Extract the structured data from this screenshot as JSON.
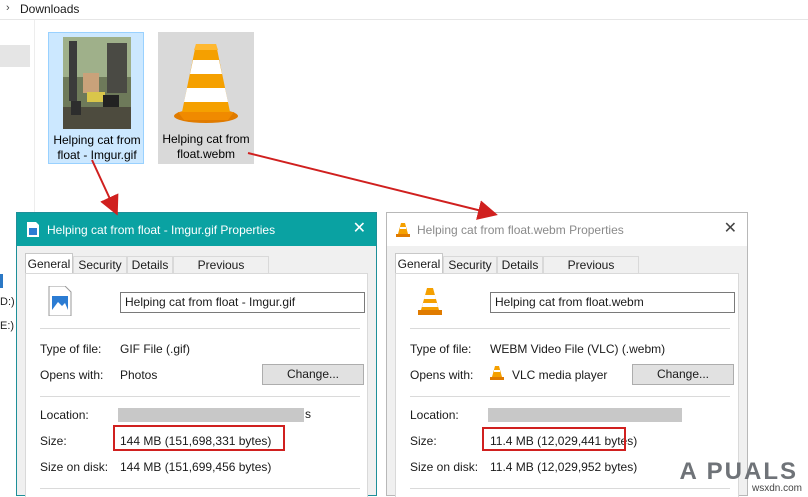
{
  "explorer": {
    "breadcrumb": "Downloads",
    "drives": [
      "D:)",
      "E:)"
    ],
    "files": [
      {
        "name_line1": "Helping cat from",
        "name_line2": "float - Imgur.gif",
        "thumb_icon": "cat-photo-thumbnail",
        "selected": true
      },
      {
        "name_line1": "Helping cat from",
        "name_line2": "float.webm",
        "thumb_icon": "vlc-cone-icon",
        "selected": false
      }
    ]
  },
  "dialog_gif": {
    "title": "Helping cat from float - Imgur.gif Properties",
    "tabs": [
      "General",
      "Security",
      "Details",
      "Previous Versions"
    ],
    "filename": "Helping cat from float - Imgur.gif",
    "type_label": "Type of file:",
    "type_value": "GIF File (.gif)",
    "opens_label": "Opens with:",
    "opens_value": "Photos",
    "change_button": "Change...",
    "location_label": "Location:",
    "location_suffix": "s",
    "size_label": "Size:",
    "size_value": "144 MB (151,698,331 bytes)",
    "disk_label": "Size on disk:",
    "disk_value": "144 MB (151,699,456 bytes)",
    "close": "✕"
  },
  "dialog_webm": {
    "title": "Helping cat from float.webm Properties",
    "tabs": [
      "General",
      "Security",
      "Details",
      "Previous Versions"
    ],
    "filename": "Helping cat from float.webm",
    "type_label": "Type of file:",
    "type_value": "WEBM Video File (VLC) (.webm)",
    "opens_label": "Opens with:",
    "opens_value": "VLC media player",
    "change_button": "Change...",
    "location_label": "Location:",
    "size_label": "Size:",
    "size_value": "11.4 MB (12,029,441 bytes)",
    "disk_label": "Size on disk:",
    "disk_value": "11.4 MB (12,029,952 bytes)",
    "close": "✕"
  },
  "watermark": "A PUALS",
  "credit": "wsxdn.com",
  "colors": {
    "titlebar_active": "#0aa2a2",
    "highlight_box": "#d0201f",
    "arrow": "#d0201f",
    "vlc_orange": "#f08a00"
  }
}
